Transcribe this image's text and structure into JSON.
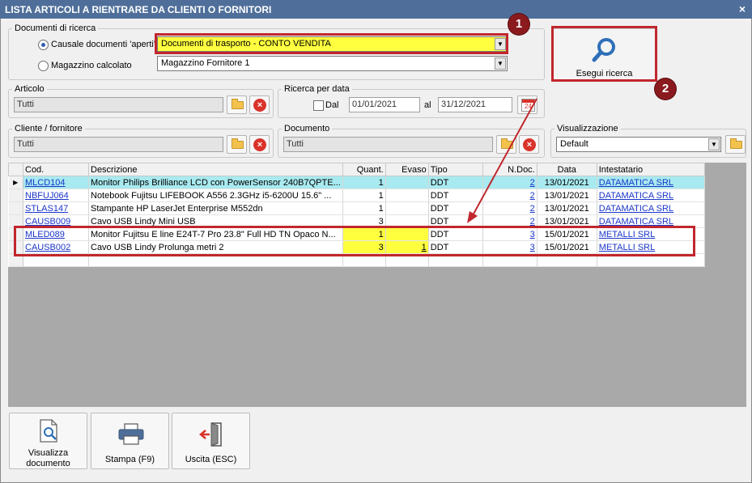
{
  "window": {
    "title": "LISTA ARTICOLI A RIENTRARE DA CLIENTI O FORNITORI",
    "close_glyph": "×"
  },
  "documenti_ricerca": {
    "legend": "Documenti di ricerca",
    "radio1_label": "Causale documenti 'aperti'",
    "radio1_value": "Documenti di trasporto - CONTO VENDITA",
    "radio2_label": "Magazzino calcolato",
    "radio2_value": "Magazzino Fornitore 1"
  },
  "search_button": {
    "label": "Esegui ricerca",
    "icon": "magnifier-icon"
  },
  "articolo": {
    "legend": "Articolo",
    "value": "Tutti"
  },
  "ricerca_data": {
    "legend": "Ricerca per data",
    "dal_label": "Dal",
    "dal_value": "01/01/2021",
    "al_label": "al",
    "al_value": "31/12/2021",
    "calendar_day": "24"
  },
  "cliente_fornitore": {
    "legend": "Cliente / fornitore",
    "value": "Tutti"
  },
  "documento": {
    "legend": "Documento",
    "value": "Tutti"
  },
  "visualizzazione": {
    "legend": "Visualizzazione",
    "value": "Default"
  },
  "grid": {
    "columns": [
      "Cod.",
      "Descrizione",
      "Quant.",
      "Evaso",
      "Tipo",
      "N.Doc.",
      "Data",
      "Intestatario"
    ],
    "rows": [
      {
        "cod": "MLCD104",
        "desc": "Monitor Philips Brilliance LCD con PowerSensor 240B7QPTE...",
        "quant": "1",
        "evaso": "",
        "tipo": "DDT",
        "ndoc": "2",
        "data": "13/01/2021",
        "intestatario": "DATAMATICA SRL"
      },
      {
        "cod": "NBFUJ064",
        "desc": "Notebook Fujitsu LIFEBOOK A556 2.3GHz i5-6200U 15.6\" ...",
        "quant": "1",
        "evaso": "",
        "tipo": "DDT",
        "ndoc": "2",
        "data": "13/01/2021",
        "intestatario": "DATAMATICA SRL"
      },
      {
        "cod": "STLAS147",
        "desc": "Stampante HP LaserJet Enterprise M552dn",
        "quant": "1",
        "evaso": "",
        "tipo": "DDT",
        "ndoc": "2",
        "data": "13/01/2021",
        "intestatario": "DATAMATICA SRL"
      },
      {
        "cod": "CAUSB009",
        "desc": "Cavo USB Lindy Mini USB",
        "quant": "3",
        "evaso": "",
        "tipo": "DDT",
        "ndoc": "2",
        "data": "13/01/2021",
        "intestatario": "DATAMATICA SRL"
      },
      {
        "cod": "MLED089",
        "desc": "Monitor Fujitsu E line E24T-7 Pro 23.8\" Full HD TN Opaco N...",
        "quant": "1",
        "evaso": "",
        "tipo": "DDT",
        "ndoc": "3",
        "data": "15/01/2021",
        "intestatario": "METALLI SRL"
      },
      {
        "cod": "CAUSB002",
        "desc": "Cavo USB Lindy Prolunga metri 2",
        "quant": "3",
        "evaso": "1",
        "tipo": "DDT",
        "ndoc": "3",
        "data": "15/01/2021",
        "intestatario": "METALLI SRL"
      }
    ]
  },
  "buttons": {
    "visualizza_line1": "Visualizza",
    "visualizza_line2": "documento",
    "stampa": "Stampa (F9)",
    "uscita": "Uscita (ESC)"
  },
  "callouts": {
    "badge1": "1",
    "badge2": "2"
  },
  "colors": {
    "title_bar": "#4f6f9a",
    "highlight_yellow": "#ffff40",
    "callout_red": "#c1272d",
    "current_row": "#a8eaf0",
    "link": "#1a35c9"
  }
}
